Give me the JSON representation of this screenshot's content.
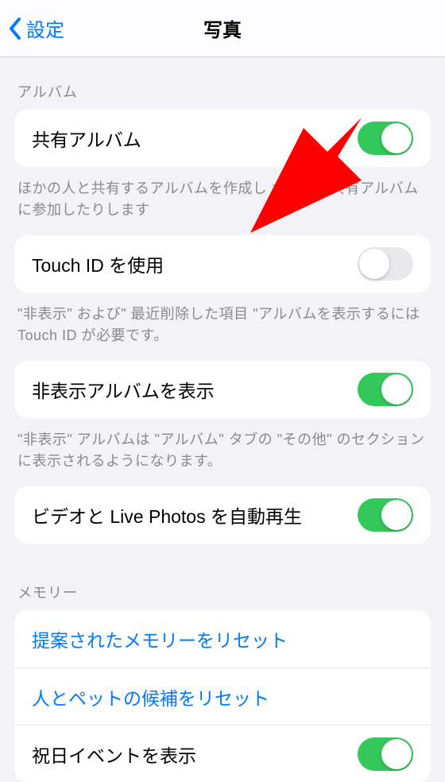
{
  "navbar": {
    "back_label": "設定",
    "title": "写真"
  },
  "sections": {
    "album": {
      "header": "アルバム",
      "shared_album_label": "共有アルバム",
      "shared_album_on": true,
      "shared_album_footer": "ほかの人と共有するアルバムを作成し             かの人の共有アルバムに参加したりします"
    },
    "touchid": {
      "label": "Touch ID を使用",
      "on": false,
      "footer": "\"非表示\" および\" 最近削除した項目 \"アルバムを表示するには Touch ID が必要です。"
    },
    "hidden_album": {
      "label": "非表示アルバムを表示",
      "on": true,
      "footer": "\"非表示\" アルバムは \"アルバム\" タブの \"その他\" のセクションに表示されるようになります。"
    },
    "autoplay": {
      "label": "ビデオと Live Photos を自動再生",
      "on": true
    },
    "memory": {
      "header": "メモリー",
      "reset_suggested_label": "提案されたメモリーをリセット",
      "reset_people_pets_label": "人とペットの候補をリセット",
      "holiday_events_label": "祝日イベントを表示",
      "holiday_events_on": true
    }
  },
  "colors": {
    "accent": "#007aff",
    "toggle_on": "#34c759",
    "annotation": "#ff0000"
  }
}
